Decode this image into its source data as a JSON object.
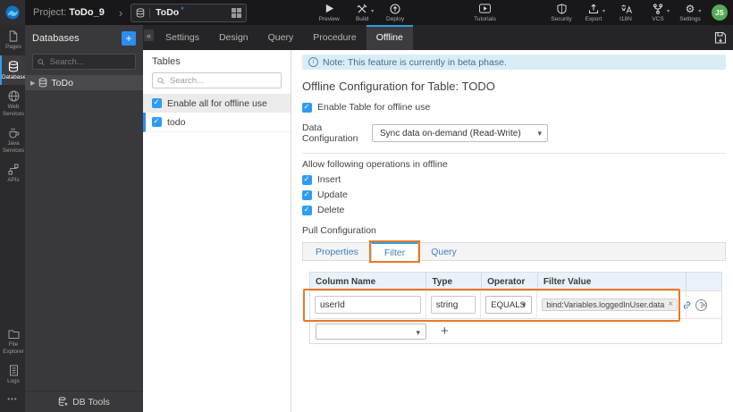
{
  "colors": {
    "accent_blue": "#2d8cf0",
    "tab_active_blue": "#2d9fd8",
    "link_blue": "#3f7fbf",
    "annotation_orange": "#ee7623",
    "note_bg": "#d9edf7",
    "avatar_green": "#56ab56"
  },
  "topbar": {
    "project_label": "Project:",
    "project_name": "ToDo_9",
    "entity_name": "ToDo",
    "modified_marker": "*",
    "actions": {
      "preview": "Preview",
      "build": "Build",
      "deploy": "Deploy",
      "tutorials": "Tutorials",
      "security": "Security",
      "export": "Export",
      "i18n": "I18N",
      "vcs": "VCS",
      "settings": "Settings"
    },
    "avatar_initials": "JS"
  },
  "sidebar": {
    "items": [
      {
        "label": "Pages"
      },
      {
        "label": "Databases"
      },
      {
        "label": "Web Services"
      },
      {
        "label": "Java Services"
      },
      {
        "label": "APIs"
      }
    ],
    "items_bottom": [
      {
        "label": "File Explorer"
      },
      {
        "label": "Logs"
      }
    ]
  },
  "db_panel": {
    "title": "Databases",
    "add_button": "+",
    "search_placeholder": "Search...",
    "tree_items": [
      {
        "label": "ToDo"
      }
    ],
    "footer_label": "DB Tools"
  },
  "workspace_tabs": {
    "items": [
      "Settings",
      "Design",
      "Query",
      "Procedure",
      "Offline"
    ],
    "active": "Offline"
  },
  "tables_panel": {
    "title": "Tables",
    "search_placeholder": "Search...",
    "enable_all_label": "Enable all for offline use",
    "items": [
      {
        "label": "todo",
        "checked": true
      }
    ]
  },
  "main": {
    "note_text": "Note: This feature is currently in beta phase.",
    "title": "Offline Configuration for Table: TODO",
    "enable_table_label": "Enable Table for offline use",
    "data_configuration": {
      "label": "Data Configuration",
      "selected": "Sync data on-demand (Read-Write)"
    },
    "operations": {
      "label": "Allow following operations in offline",
      "items": [
        "Insert",
        "Update",
        "Delete"
      ]
    },
    "pull_configuration": {
      "label": "Pull Configuration",
      "tabs": [
        "Properties",
        "Filter",
        "Query"
      ],
      "active_tab": "Filter"
    },
    "filter_table": {
      "headers": [
        "Column Name",
        "Type",
        "Operator",
        "Filter Value"
      ],
      "rows": [
        {
          "column_name": "userId",
          "type": "string",
          "operator": "EQUALS",
          "filter_value": "bind:Variables.loggedInUser.data"
        }
      ],
      "add_row_button": "+"
    }
  }
}
